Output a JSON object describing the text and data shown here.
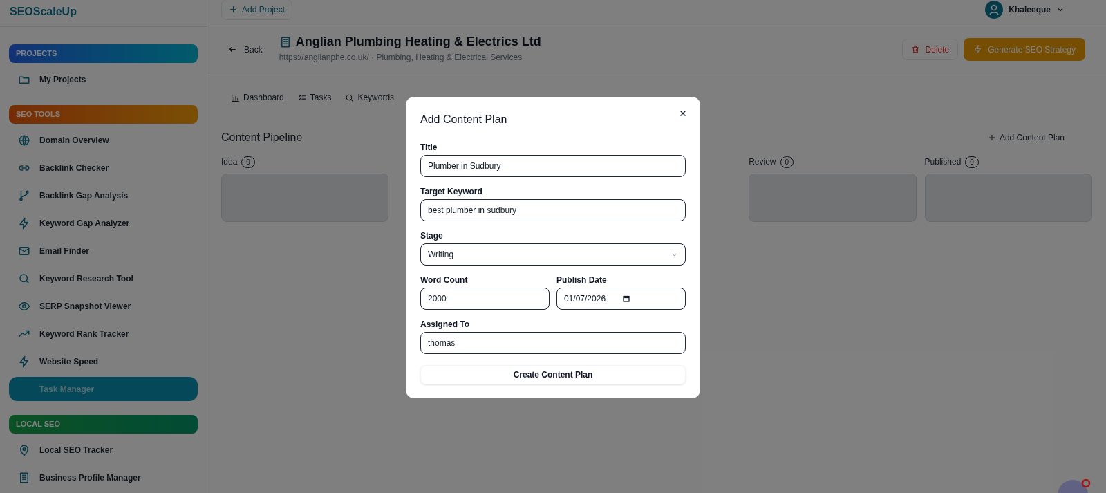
{
  "sidebar": {
    "logo": "SEOScaleUp",
    "sections": [
      {
        "title": "PROJECTS",
        "kind": "projects",
        "items": [
          {
            "label": "My Projects",
            "selected": false
          }
        ]
      },
      {
        "title": "SEO TOOLS",
        "kind": "tools",
        "items": [
          {
            "label": "Domain Overview",
            "selected": false
          },
          {
            "label": "Backlink Checker",
            "selected": false
          },
          {
            "label": "Backlink Gap Analysis",
            "selected": false
          },
          {
            "label": "Keyword Gap Analyzer",
            "selected": false
          },
          {
            "label": "Email Finder",
            "selected": false
          },
          {
            "label": "Keyword Research Tool",
            "selected": false
          },
          {
            "label": "SERP Snapshot Viewer",
            "selected": false
          },
          {
            "label": "Keyword Rank Tracker",
            "selected": false
          },
          {
            "label": "Website Speed",
            "selected": false
          },
          {
            "label": "Task Manager",
            "selected": true
          }
        ]
      },
      {
        "title": "LOCAL SEO",
        "kind": "local",
        "items": [
          {
            "label": "Local SEO Tracker",
            "selected": false
          },
          {
            "label": "Business Profile Manager",
            "selected": false
          }
        ]
      }
    ]
  },
  "topbar": {
    "add_project": "Add Project",
    "user": "Khaleeque"
  },
  "project": {
    "back": "Back",
    "name": "Anglian Plumbing Heating & Electrics Ltd",
    "subtitle": "https://anglianphe.co.uk/ · Plumbing, Heating & Electrical Services",
    "delete": "Delete",
    "generate": "Generate SEO Strategy"
  },
  "tabs": [
    {
      "label": "Dashboard",
      "selected": false
    },
    {
      "label": "Tasks",
      "selected": false
    },
    {
      "label": "Keywords",
      "selected": false
    }
  ],
  "pipeline": {
    "title": "Content Pipeline",
    "add": "Add Content Plan",
    "columns": [
      {
        "label": "Idea",
        "count": "0"
      },
      {
        "label": "Review",
        "count": "0"
      },
      {
        "label": "Published",
        "count": "0"
      }
    ]
  },
  "modal": {
    "title": "Add Content Plan",
    "fields": [
      {
        "label": "Title",
        "kind": "text",
        "value": "Plumber in Sudbury"
      },
      {
        "label": "Target Keyword",
        "kind": "text",
        "value": "best plumber in sudbury"
      },
      {
        "label": "Stage",
        "kind": "select",
        "value": "Writing"
      },
      {
        "label": "Word Count",
        "kind": "text",
        "value": "2000"
      },
      {
        "label": "Publish Date",
        "kind": "date",
        "value": "01/07/2026"
      },
      {
        "label": "Assigned To",
        "kind": "text",
        "value": "thomas"
      }
    ],
    "submit": "Create Content Plan"
  }
}
